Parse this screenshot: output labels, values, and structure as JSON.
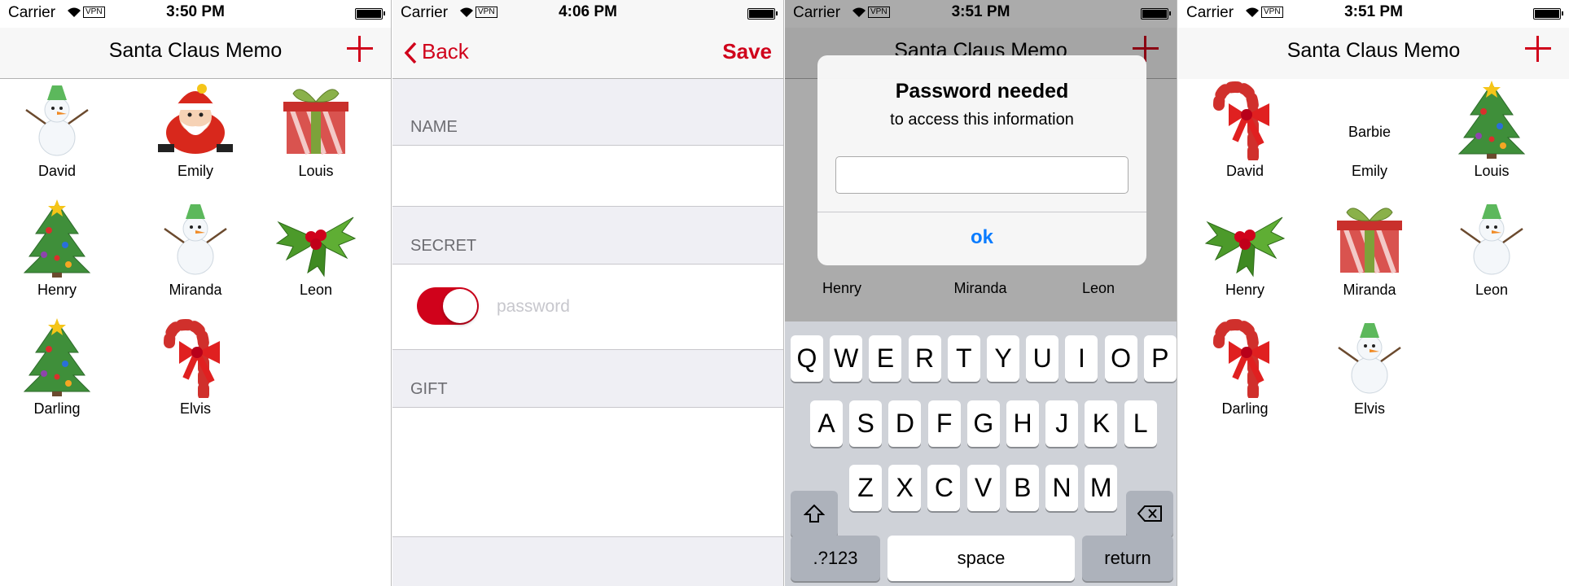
{
  "screen1": {
    "status": {
      "carrier": "Carrier",
      "vpn": "VPN",
      "time": "3:50 PM"
    },
    "title": "Santa Claus Memo",
    "items": [
      {
        "name": "David",
        "icon": "snowman"
      },
      {
        "name": "Emily",
        "icon": "santa"
      },
      {
        "name": "Louis",
        "icon": "gift"
      },
      {
        "name": "Henry",
        "icon": "tree"
      },
      {
        "name": "Miranda",
        "icon": "snowman"
      },
      {
        "name": "Leon",
        "icon": "holly"
      },
      {
        "name": "Darling",
        "icon": "tree"
      },
      {
        "name": "Elvis",
        "icon": "candy-cane"
      }
    ]
  },
  "screen2": {
    "status": {
      "carrier": "Carrier",
      "vpn": "VPN",
      "time": "4:06 PM"
    },
    "back_label": "Back",
    "save_label": "Save",
    "name_header": "NAME",
    "secret_header": "SECRET",
    "password_placeholder": "password",
    "secret_on": true,
    "gift_header": "GIFT"
  },
  "screen3": {
    "status": {
      "carrier": "Carrier",
      "vpn": "VPN",
      "time": "3:51 PM"
    },
    "title": "Santa Claus Memo",
    "alert_title": "Password needed",
    "alert_message": "to access this information",
    "alert_button": "ok",
    "bg_labels": [
      "Henry",
      "Miranda",
      "Leon"
    ],
    "keys_row1": [
      "Q",
      "W",
      "E",
      "R",
      "T",
      "Y",
      "U",
      "I",
      "O",
      "P"
    ],
    "keys_row2": [
      "A",
      "S",
      "D",
      "F",
      "G",
      "H",
      "J",
      "K",
      "L"
    ],
    "keys_row3": [
      "Z",
      "X",
      "C",
      "V",
      "B",
      "N",
      "M"
    ],
    "key_numbers": ".?123",
    "key_space": "space",
    "key_return": "return"
  },
  "screen4": {
    "status": {
      "carrier": "Carrier",
      "vpn": "VPN",
      "time": "3:51 PM"
    },
    "title": "Santa Claus Memo",
    "items": [
      {
        "name": "David",
        "icon": "candy-cane"
      },
      {
        "name": "Emily",
        "text": "Barbie"
      },
      {
        "name": "Louis",
        "icon": "tree"
      },
      {
        "name": "Henry",
        "icon": "holly"
      },
      {
        "name": "Miranda",
        "icon": "gift"
      },
      {
        "name": "Leon",
        "icon": "snowman"
      },
      {
        "name": "Darling",
        "icon": "candy-cane"
      },
      {
        "name": "Elvis",
        "icon": "snowman"
      }
    ]
  }
}
